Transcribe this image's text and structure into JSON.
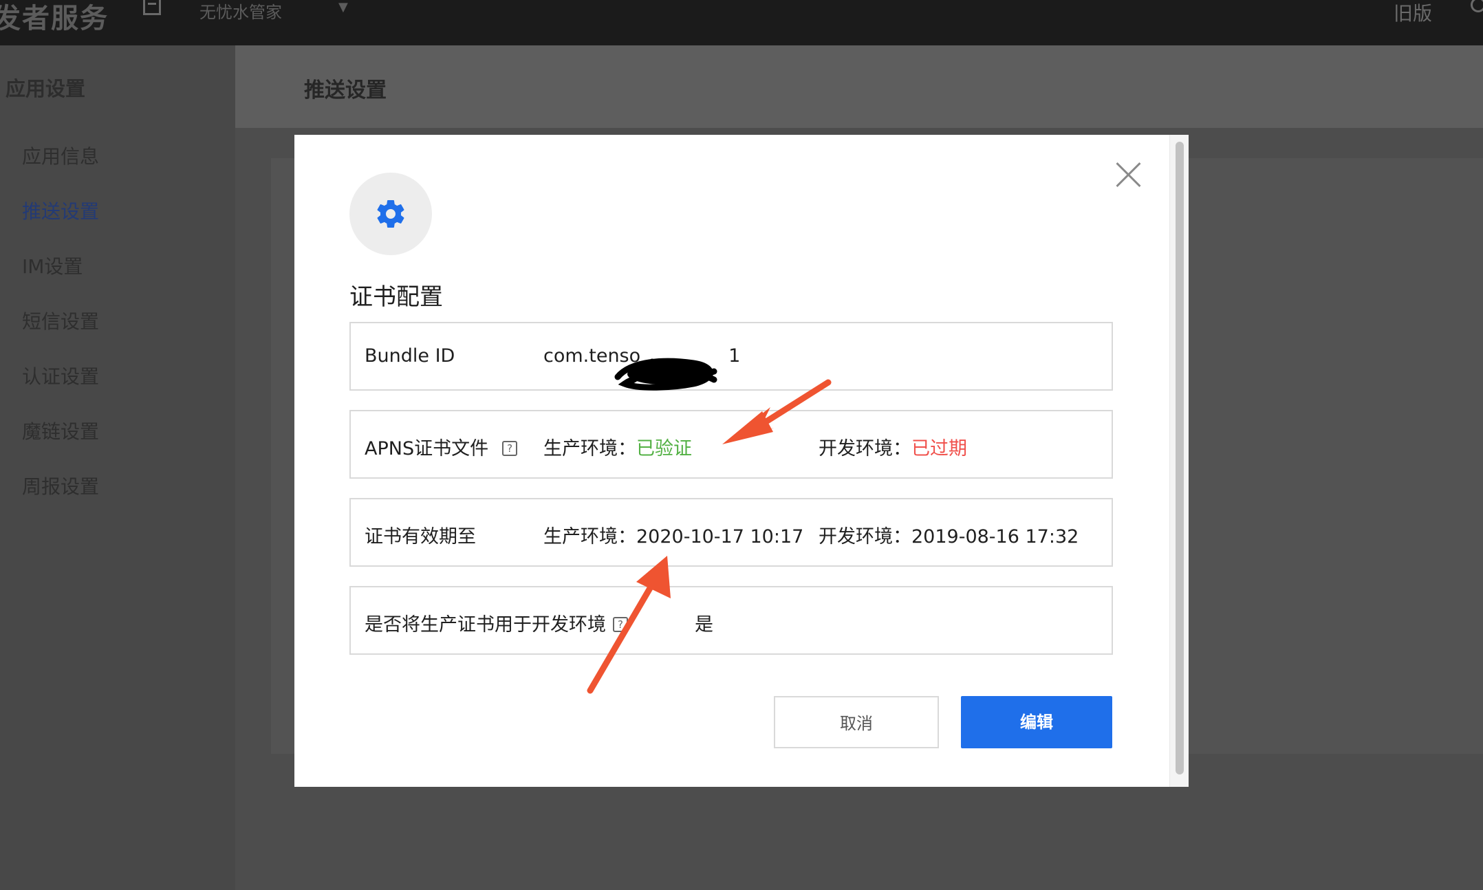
{
  "topbar": {
    "brand": "发者服务",
    "app_name": "无忧水管家",
    "old_version": "旧版"
  },
  "sidebar": {
    "title": "应用设置",
    "items": [
      {
        "label": "应用信息",
        "active": false
      },
      {
        "label": "推送设置",
        "active": true
      },
      {
        "label": "IM设置",
        "active": false
      },
      {
        "label": "短信设置",
        "active": false
      },
      {
        "label": "认证设置",
        "active": false
      },
      {
        "label": "魔链设置",
        "active": false
      },
      {
        "label": "周报设置",
        "active": false
      }
    ]
  },
  "page": {
    "title": "推送设置"
  },
  "modal": {
    "title": "证书配置",
    "rows": {
      "bundle": {
        "label": "Bundle ID",
        "value": "com.tenso",
        "value_tail": "1"
      },
      "apns": {
        "label": "APNS证书文件",
        "help": "?",
        "prod_label": "生产环境：",
        "prod_status": "已验证",
        "dev_label": "开发环境：",
        "dev_status": "已过期"
      },
      "expiry": {
        "label": "证书有效期至",
        "prod_label": "生产环境：",
        "prod_date": "2020-10-17 10:17",
        "dev_label": "开发环境：",
        "dev_date": "2019-08-16 17:32"
      },
      "use_prod": {
        "label": "是否将生产证书用于开发环境",
        "help": "?",
        "value": "是"
      }
    },
    "buttons": {
      "cancel": "取消",
      "edit": "编辑"
    }
  },
  "colors": {
    "primary": "#1f6fea",
    "verified": "#52b043",
    "expired": "#f0504b",
    "annotation_arrow": "#ef5431"
  },
  "icons": [
    "gear-icon",
    "close-icon",
    "help-icon",
    "doc-icon",
    "chevron-down-icon"
  ]
}
